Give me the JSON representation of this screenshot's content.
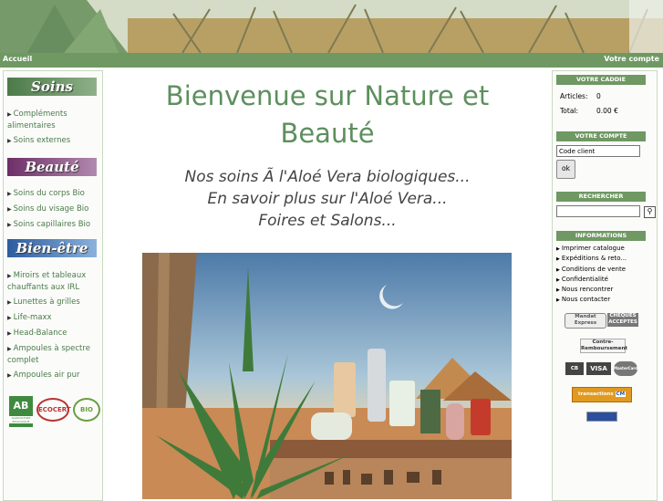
{
  "nav": {
    "home": "Accueil",
    "account": "Votre compte"
  },
  "left": {
    "soins": {
      "header": "Soins",
      "items": [
        "Compléments alimentaires",
        "Soins externes"
      ]
    },
    "beaute": {
      "header": "Beauté",
      "items": [
        "Soins du corps Bio",
        "Soins du visage Bio",
        "Soins capillaires Bio"
      ]
    },
    "bienetre": {
      "header": "Bien-être",
      "items": [
        "Miroirs et tableaux chauffants aux IRL",
        "Lunettes à grilles",
        "Life-maxx",
        "Head-Balance",
        "Ampoules à spectre complet",
        "Ampoules air pur"
      ]
    },
    "labels": {
      "ab": "AB",
      "ab_sub": "AGRICULTURE BIOLOGIQUE",
      "ecocert": "ECOCERT",
      "bio": "BIO"
    }
  },
  "main": {
    "title": "Bienvenue sur Nature et Beauté",
    "links": [
      "Nos soins Ã  l'Aloé Vera biologiques...",
      "En savoir plus sur l'Aloé Vera...",
      "Foires et Salons..."
    ]
  },
  "right": {
    "cart": {
      "header": "VOTRE CADDIE",
      "articles_label": "Articles:",
      "articles_value": "0",
      "total_label": "Total:",
      "total_value": "0.00 €"
    },
    "account": {
      "header": "VOTRE COMPTE",
      "placeholder": "Code client",
      "ok": "ok"
    },
    "search": {
      "header": "RECHERCHER"
    },
    "info": {
      "header": "INFORMATIONS",
      "items": [
        "Imprimer catalogue",
        "Expéditions & reto...",
        "Conditions de vente",
        "Confidentialité",
        "Nous rencontrer",
        "Nous contacter"
      ]
    },
    "payments": {
      "mandat": "Mandat Express",
      "cheques": "CHEQUES ACCEPTES",
      "contre": "Contre-Remboursement",
      "cb": "CB",
      "visa": "VISA",
      "mastercard": "MasterCard",
      "transactions": "transactions",
      "cm": "CM"
    }
  }
}
